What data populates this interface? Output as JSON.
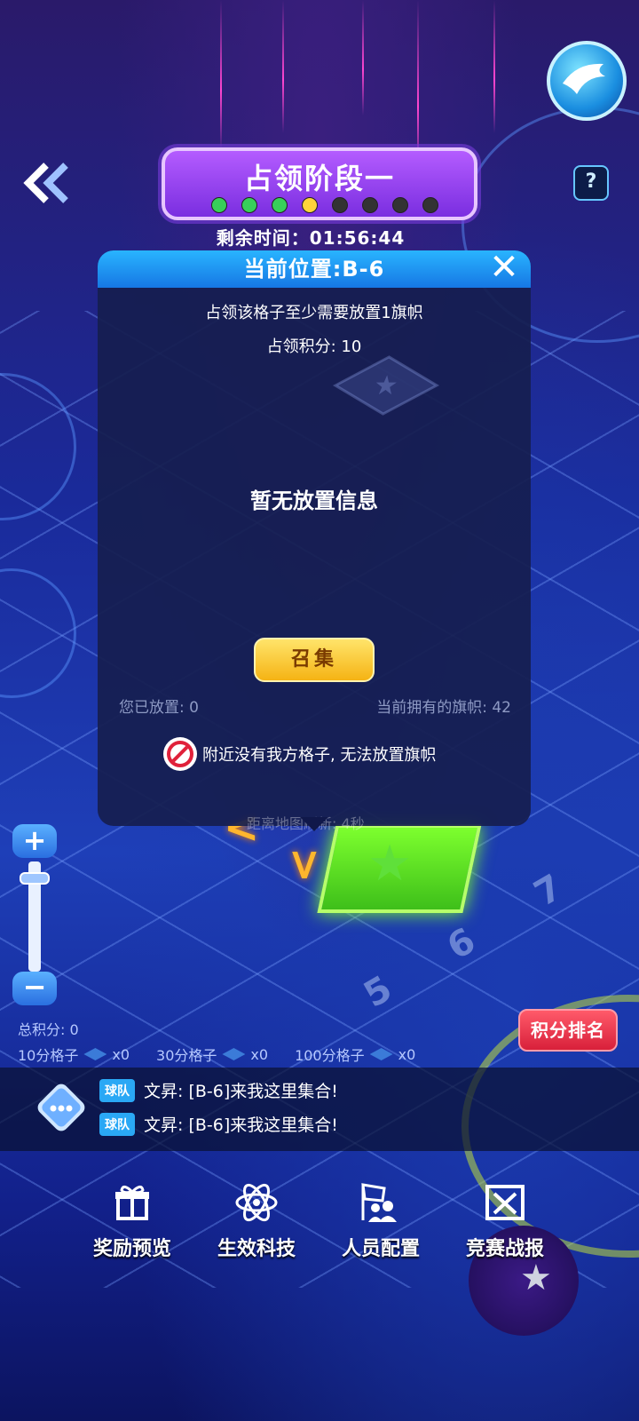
{
  "stage": {
    "title": "占领阶段一",
    "timer_label": "剩余时间：01:56:44",
    "dots": [
      "done",
      "done",
      "done",
      "current",
      "pending",
      "pending",
      "pending",
      "pending"
    ]
  },
  "modal": {
    "title": "当前位置:B-6",
    "close": "✕",
    "requirement": "占领该格子至少需要放置1旗帜",
    "score": "占领积分: 10",
    "empty_text": "暂无放置信息",
    "summon_label": "召集",
    "placed_label": "您已放置: 0",
    "owned_label": "当前拥有的旗帜: 42",
    "warning": "附近没有我方格子, 无法放置旗帜"
  },
  "map": {
    "refresh_text": "距离地图刷新: 4秒",
    "tile_numbers": [
      "7",
      "6",
      "5"
    ]
  },
  "zoom": {
    "plus": "+",
    "minus": "−"
  },
  "stats": {
    "total_score": "总积分: 0",
    "cells": [
      {
        "label": "10分格子",
        "count": "x0"
      },
      {
        "label": "30分格子",
        "count": "x0"
      },
      {
        "label": "100分格子",
        "count": "x0"
      }
    ]
  },
  "rank_button": "积分排名",
  "chat": {
    "messages": [
      {
        "tag": "球队",
        "text": "文昇: [B-6]来我这里集合!"
      },
      {
        "tag": "球队",
        "text": "文昇: [B-6]来我这里集合!"
      }
    ]
  },
  "nav": {
    "items": [
      {
        "label": "奖励预览",
        "icon": "gift-icon"
      },
      {
        "label": "生效科技",
        "icon": "atom-icon"
      },
      {
        "label": "人员配置",
        "icon": "people-flag-icon"
      },
      {
        "label": "竞赛战报",
        "icon": "battle-report-icon"
      }
    ]
  },
  "colors": {
    "accent_blue": "#1677e4",
    "stage_purple": "#7a2ee0",
    "summon_gold": "#f5b314",
    "rank_red": "#d8203a",
    "tile_green": "#7dff2e"
  }
}
